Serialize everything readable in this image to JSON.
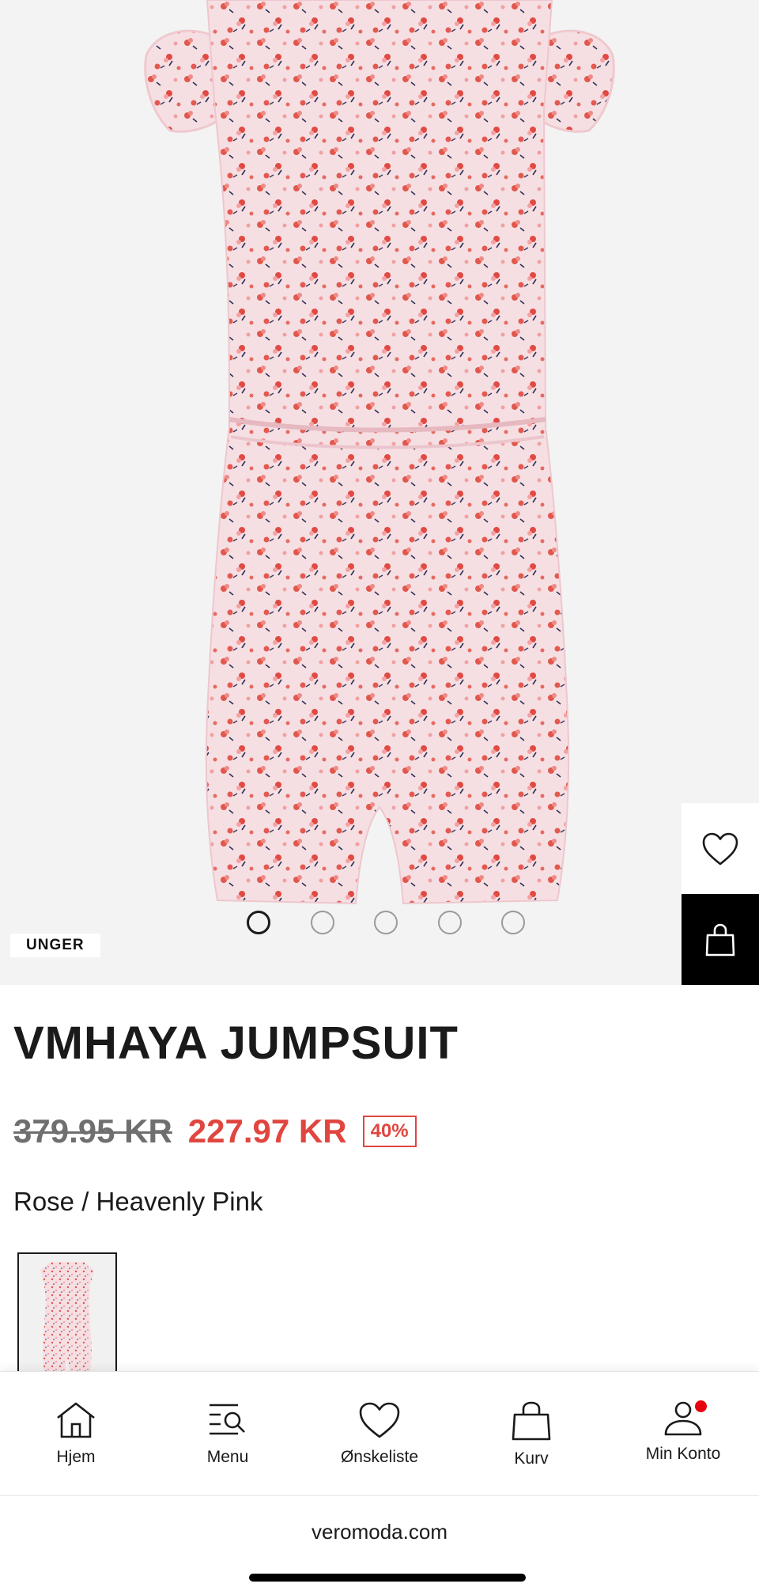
{
  "product": {
    "category_tag": "UNGER",
    "title": "VMHAYA JUMPSUIT",
    "price_original": "379.95 KR",
    "price_sale": "227.97 KR",
    "discount": "40%",
    "color_name": "Rose / Heavenly Pink",
    "gallery_count": 5,
    "gallery_active_index": 0
  },
  "actions": {
    "wishlist_icon": "heart-icon",
    "bag_icon": "bag-icon"
  },
  "bottom_nav": {
    "items": [
      {
        "label": "Hjem",
        "icon": "home-icon"
      },
      {
        "label": "Menu",
        "icon": "menu-search-icon"
      },
      {
        "label": "Ønskeliste",
        "icon": "heart-icon"
      },
      {
        "label": "Kurv",
        "icon": "bag-icon"
      },
      {
        "label": "Min Konto",
        "icon": "account-icon"
      }
    ]
  },
  "browser": {
    "url": "veromoda.com"
  },
  "colors": {
    "sale_red": "#e0463f",
    "old_price_gray": "#6f6f6f",
    "notification_red": "#e8000d",
    "fabric_pink": "#f7dde2"
  }
}
